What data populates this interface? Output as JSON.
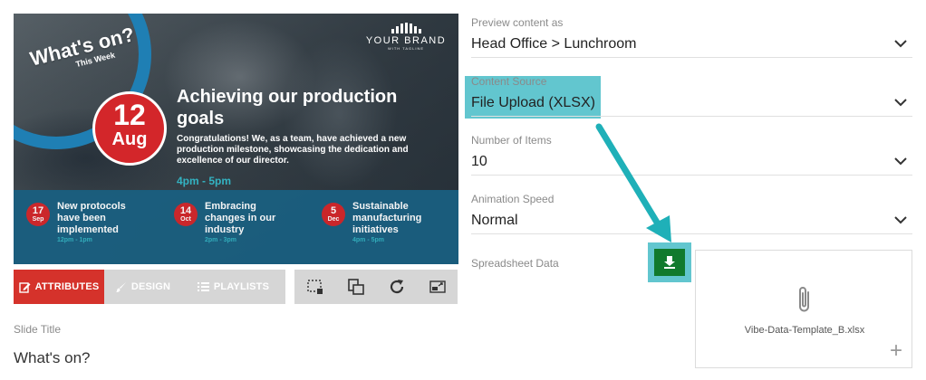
{
  "preview": {
    "brand_name": "YOUR BRAND",
    "brand_tagline": "WITH TAGLINE",
    "whats_on_title": "What's on?",
    "whats_on_sub": "This Week",
    "date_day": "12",
    "date_month": "Aug",
    "headline": "Achieving our production goals",
    "description": "Congratulations! We, as a team, have achieved a new production milestone, showcasing the dedication and excellence of our director.",
    "time": "4pm - 5pm",
    "events": [
      {
        "day": "17",
        "month": "Sep",
        "title": "New protocols have been implemented",
        "time": "12pm - 1pm"
      },
      {
        "day": "14",
        "month": "Oct",
        "title": "Embracing changes in our industry",
        "time": "2pm - 3pm"
      },
      {
        "day": "5",
        "month": "Dec",
        "title": "Sustainable manufacturing initiatives",
        "time": "4pm - 5pm"
      }
    ]
  },
  "tabs": {
    "attributes": "ATTRIBUTES",
    "design": "DESIGN",
    "playlists": "PLAYLISTS"
  },
  "tools": [
    "crop-icon",
    "layers-icon",
    "refresh-icon",
    "resize-icon"
  ],
  "slide_title": {
    "label": "Slide Title",
    "value": "What's on?"
  },
  "fields": {
    "preview_as": {
      "label": "Preview content as",
      "value": "Head Office > Lunchroom"
    },
    "content_source": {
      "label": "Content Source",
      "value": "File Upload (XLSX)"
    },
    "number_items": {
      "label": "Number of Items",
      "value": "10"
    },
    "animation_speed": {
      "label": "Animation Speed",
      "value": "Normal"
    }
  },
  "spreadsheet": {
    "label": "Spreadsheet Data",
    "file_name": "Vibe-Data-Template_B.xlsx",
    "plus": "+"
  },
  "colors": {
    "accent_red": "#d5322b",
    "highlight_teal": "#62c6cf",
    "download_green": "#117a2d",
    "preview_blue": "#1a5f80"
  }
}
